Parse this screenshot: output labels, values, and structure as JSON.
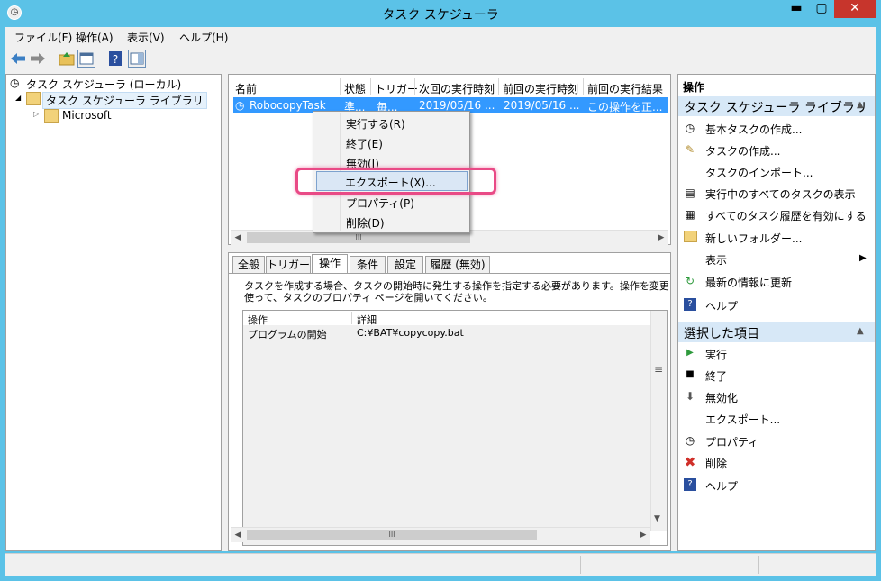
{
  "window": {
    "title": "タスク スケジューラ",
    "min": "▬",
    "max": "▢",
    "close": "✕"
  },
  "menubar": {
    "items": [
      "ファイル(F)",
      "操作(A)",
      "表示(V)",
      "ヘルプ(H)"
    ]
  },
  "tree": {
    "root": "タスク スケジューラ (ローカル)",
    "library": "タスク スケジューラ ライブラリ",
    "microsoft": "Microsoft"
  },
  "task_list": {
    "columns": [
      "名前",
      "状態",
      "トリガー",
      "次回の実行時刻",
      "前回の実行時刻",
      "前回の実行結果"
    ],
    "rows": [
      {
        "name": "RobocopyTask",
        "status": "準...",
        "trigger": "毎...",
        "next": "2019/05/16 ...",
        "last": "2019/05/16 ...",
        "result": "この操作を正..."
      }
    ],
    "scroll_grip": "III"
  },
  "context_menu": {
    "items": [
      "実行する(R)",
      "終了(E)",
      "無効(I)",
      "エクスポート(X)...",
      "プロパティ(P)",
      "削除(D)"
    ],
    "selected": "エクスポート(X)..."
  },
  "detail_tabs": {
    "items": [
      "全般",
      "トリガー",
      "操作",
      "条件",
      "設定",
      "履歴 (無効)"
    ],
    "active": "操作"
  },
  "detail": {
    "description_line1": "タスクを作成する場合、タスクの開始時に発生する操作を指定する必要があります。操作を変更す",
    "description_line2": "使って、タスクのプロパティ ページを開いてください。",
    "columns": [
      "操作",
      "詳細"
    ],
    "rows": [
      {
        "action": "プログラムの開始",
        "detail": "C:¥BAT¥copycopy.bat"
      }
    ],
    "scroll_grip": "III",
    "vscroll_grip": "≡"
  },
  "actions_pane": {
    "title": "操作",
    "section1": "タスク スケジューラ ライブラリ",
    "section1_items": [
      "基本タスクの作成...",
      "タスクの作成...",
      "タスクのインポート...",
      "実行中のすべてのタスクの表示",
      "すべてのタスク履歴を有効にする",
      "新しいフォルダー...",
      "表示",
      "最新の情報に更新",
      "ヘルプ"
    ],
    "section2": "選択した項目",
    "section2_items": [
      "実行",
      "終了",
      "無効化",
      "エクスポート...",
      "プロパティ",
      "削除",
      "ヘルプ"
    ],
    "collapse_arrow": "▲",
    "submenu_arrow": "▶"
  },
  "colors": {
    "titlebar": "#5bc2e7",
    "selection": "#3399ff",
    "highlight": "#e94a86",
    "close": "#c7352c"
  }
}
